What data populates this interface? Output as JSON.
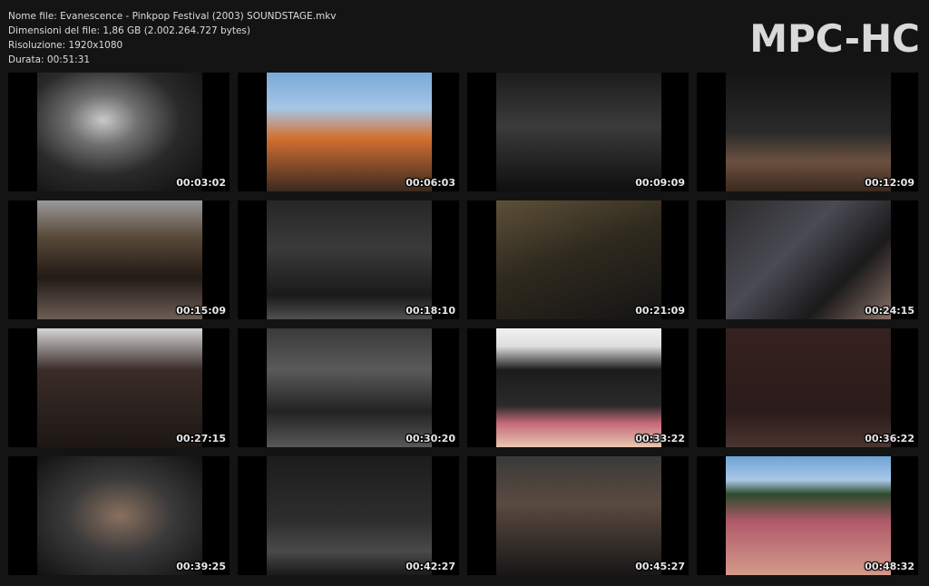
{
  "header": {
    "file_name": "Nome file: Evanescence - Pinkpop Festival (2003) SOUNDSTAGE.mkv",
    "file_size": "Dimensioni del file: 1,86 GB (2.002.264.727 bytes)",
    "resolution": "Risoluzione: 1920x1080",
    "duration": "Durata: 00:51:31",
    "logo": "MPC-HC"
  },
  "thumbnails": [
    {
      "time": "00:03:02",
      "scene": "s1"
    },
    {
      "time": "00:06:03",
      "scene": "s2"
    },
    {
      "time": "00:09:09",
      "scene": "s3"
    },
    {
      "time": "00:12:09",
      "scene": "s4"
    },
    {
      "time": "00:15:09",
      "scene": "s5"
    },
    {
      "time": "00:18:10",
      "scene": "s6"
    },
    {
      "time": "00:21:09",
      "scene": "s7"
    },
    {
      "time": "00:24:15",
      "scene": "s8"
    },
    {
      "time": "00:27:15",
      "scene": "s9"
    },
    {
      "time": "00:30:20",
      "scene": "s10"
    },
    {
      "time": "00:33:22",
      "scene": "s11"
    },
    {
      "time": "00:36:22",
      "scene": "s12"
    },
    {
      "time": "00:39:25",
      "scene": "s13"
    },
    {
      "time": "00:42:27",
      "scene": "s14"
    },
    {
      "time": "00:45:27",
      "scene": "s15"
    },
    {
      "time": "00:48:32",
      "scene": "s16"
    }
  ]
}
